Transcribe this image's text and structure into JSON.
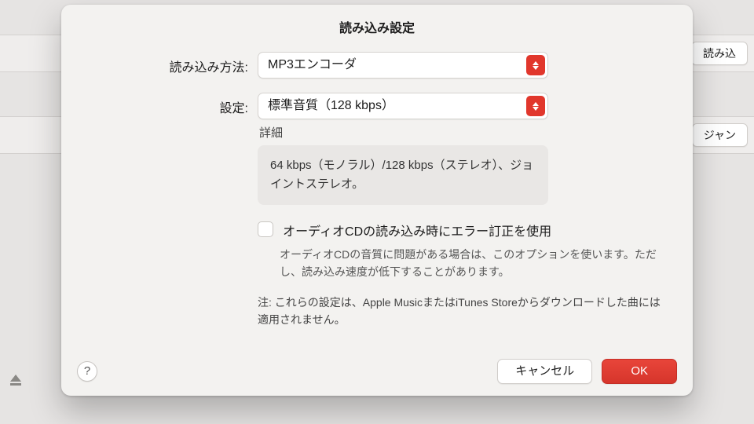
{
  "bg": {
    "button_top": "読み込",
    "button_mid": "ジャン"
  },
  "dialog": {
    "title": "読み込み設定",
    "import_label": "読み込み方法:",
    "import_value": "MP3エンコーダ",
    "setting_label": "設定:",
    "setting_value": "標準音質（128 kbps）",
    "details_label": "詳細",
    "details_text": "64 kbps（モノラル）/128 kbps（ステレオ）、ジョイントステレオ。",
    "error_correction_label": "オーディオCDの読み込み時にエラー訂正を使用",
    "error_correction_desc": "オーディオCDの音質に問題がある場合は、このオプションを使います。ただし、読み込み速度が低下することがあります。",
    "note": "注: これらの設定は、Apple MusicまたはiTunes Storeからダウンロードした曲には適用されません。",
    "help": "?",
    "cancel": "キャンセル",
    "ok": "OK"
  }
}
